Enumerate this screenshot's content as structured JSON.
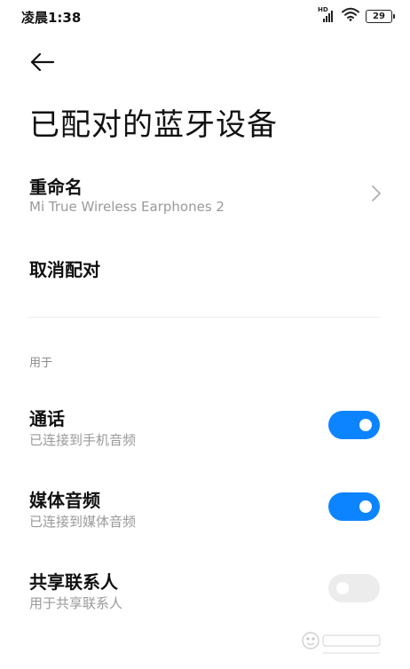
{
  "status_bar": {
    "time": "凌晨1:38",
    "network": "HD",
    "battery": "29"
  },
  "header": {
    "back_icon": "arrow-left-icon",
    "title": "已配对的蓝牙设备"
  },
  "rename": {
    "label": "重命名",
    "value": "Mi True Wireless Earphones 2",
    "chevron_icon": "chevron-right-icon"
  },
  "unpair": {
    "label": "取消配对"
  },
  "section": {
    "header": "用于"
  },
  "prefs": [
    {
      "title": "通话",
      "subtitle": "已连接到手机音频",
      "enabled": true
    },
    {
      "title": "媒体音频",
      "subtitle": "已连接到媒体音频",
      "enabled": true
    },
    {
      "title": "共享联系人",
      "subtitle": "用于共享联系人",
      "enabled": false
    }
  ],
  "colors": {
    "toggle_on": "#0d84ff",
    "toggle_off": "#ececec",
    "secondary_text": "#9a9a9a"
  }
}
